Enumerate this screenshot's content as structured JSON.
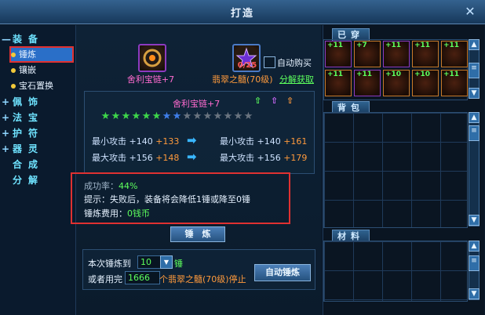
{
  "window": {
    "title": "打造"
  },
  "nav": {
    "categories": [
      {
        "mark": "—",
        "label": "装备"
      },
      {
        "mark": "+",
        "label": "佩饰"
      },
      {
        "mark": "+",
        "label": "法宝"
      },
      {
        "mark": "+",
        "label": "护符"
      },
      {
        "mark": "+",
        "label": "器灵"
      },
      {
        "mark": "",
        "label": "合成"
      },
      {
        "mark": "",
        "label": "分解"
      }
    ],
    "subitems": [
      "锤炼",
      "镶嵌",
      "宝石置换"
    ],
    "active": "锤炼"
  },
  "item": {
    "name_top": "舍利宝链+7",
    "name_mid": "舍利宝链+7",
    "material_name": "翡翠之髓(70级)",
    "material_count": "0/25",
    "auto_buy_label": "自动购买",
    "decompose_link": "分解获取"
  },
  "stars": {
    "green": 6,
    "blue": 2,
    "grey": 7
  },
  "stats": [
    {
      "label": "最小攻击",
      "cur": "+140",
      "bonus": "+133",
      "new_label": "最小攻击",
      "new_cur": "+140",
      "new_bonus": "+161"
    },
    {
      "label": "最大攻击",
      "cur": "+156",
      "bonus": "+148",
      "new_label": "最大攻击",
      "new_cur": "+156",
      "new_bonus": "+179"
    }
  ],
  "info": {
    "success_label": "成功率：",
    "success_value": "44%",
    "hint": "提示：失败后，装备将会降低1锤或降至0锤",
    "cost_label": "锤炼费用：",
    "cost_value": "0钱币"
  },
  "buttons": {
    "hammer": "锤　炼",
    "auto_hammer": "自动锤炼"
  },
  "auto": {
    "line1_prefix": "本次锤炼到",
    "target_value": "10",
    "line1_suffix": "锤",
    "line2_prefix": "或者用完",
    "use_value": "1666",
    "line2_suffix": "个翡翠之髓(70级)停止"
  },
  "right": {
    "equipped_tab": "已穿",
    "bag_tab": "背包",
    "material_tab": "材料",
    "equipped_items": [
      "+11",
      "+7",
      "+11",
      "+11",
      "+11",
      "+11",
      "+11",
      "+10",
      "+10",
      "+11"
    ]
  },
  "colors": {
    "accent": "#6fe3ff",
    "highlight": "#e03131",
    "bonus": "#ff9a3c",
    "success": "#5dff5d"
  }
}
